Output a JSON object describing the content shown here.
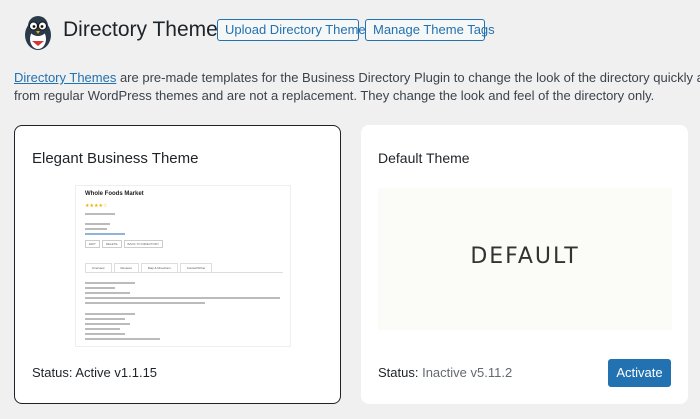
{
  "header": {
    "title": "Directory Themes",
    "upload_label": "Upload Directory Theme",
    "manage_label": "Manage Theme Tags"
  },
  "description": {
    "link_text": "Directory Themes",
    "line1_rest": " are pre-made templates for the Business Directory Plugin to change the look of the directory quickly and easily. We hav",
    "line2": "from regular WordPress themes and are not a replacement. They change the look and feel of the directory only."
  },
  "themes": [
    {
      "title": "Elegant Business Theme",
      "status_label": "Status:",
      "status_value": "Active v1.1.15",
      "preview": {
        "listing_title": "Whole Foods Market",
        "stars": "★★★★☆",
        "buttons": [
          "EDIT",
          "DELETE",
          "BACK TO DIRECTORY"
        ],
        "tabs": [
          "Overview",
          "Reviews",
          "Map & Directions",
          "Contact/Other"
        ]
      }
    },
    {
      "title": "Default Theme",
      "status_label": "Status:",
      "status_value": "Inactive v5.11.2",
      "preview_label": "DEFAULT",
      "action_label": "Activate"
    }
  ],
  "colors": {
    "accent": "#2271b1",
    "background": "#f0f0f1",
    "card": "#ffffff"
  }
}
